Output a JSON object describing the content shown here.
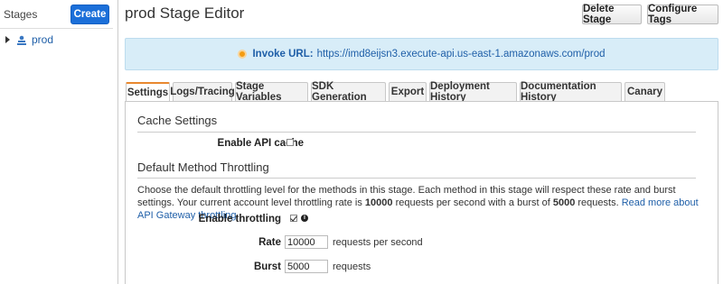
{
  "sidebar": {
    "title": "Stages",
    "create_label": "Create",
    "stages": [
      {
        "label": "prod",
        "icon": "stage-icon"
      }
    ]
  },
  "header": {
    "title": "prod Stage Editor",
    "delete_label": "Delete Stage",
    "configure_label": "Configure Tags"
  },
  "invoke": {
    "label": "Invoke URL:",
    "url": "https://imd8eijsn3.execute-api.us-east-1.amazonaws.com/prod"
  },
  "tabs": [
    {
      "label": "Settings",
      "active": true
    },
    {
      "label": "Logs/Tracing"
    },
    {
      "label": "Stage Variables"
    },
    {
      "label": "SDK Generation"
    },
    {
      "label": "Export"
    },
    {
      "label": "Deployment History"
    },
    {
      "label": "Documentation History"
    },
    {
      "label": "Canary"
    }
  ],
  "settings": {
    "cache_title": "Cache Settings",
    "enable_cache_label": "Enable API cache",
    "enable_cache_checked": false,
    "throttling_title": "Default Method Throttling",
    "desc_part1": "Choose the default throttling level for the methods in this stage. Each method in this stage will respect these rate and burst settings. Your current account level throttling rate is ",
    "desc_rate": "10000",
    "desc_part2": " requests per second with a burst of ",
    "desc_burst": "5000",
    "desc_part3": " requests. ",
    "desc_link": "Read more about API Gateway throttling",
    "enable_throttling_label": "Enable throttling",
    "enable_throttling_checked": true,
    "rate_label": "Rate",
    "rate_value": "10000",
    "rate_unit": "requests per second",
    "burst_label": "Burst",
    "burst_value": "5000",
    "burst_unit": "requests"
  },
  "colors": {
    "primary_button": "#1b6fd9",
    "link": "#1f5fa8",
    "active_tab_accent": "#e8882f",
    "invoke_bg": "#d8edf8"
  }
}
